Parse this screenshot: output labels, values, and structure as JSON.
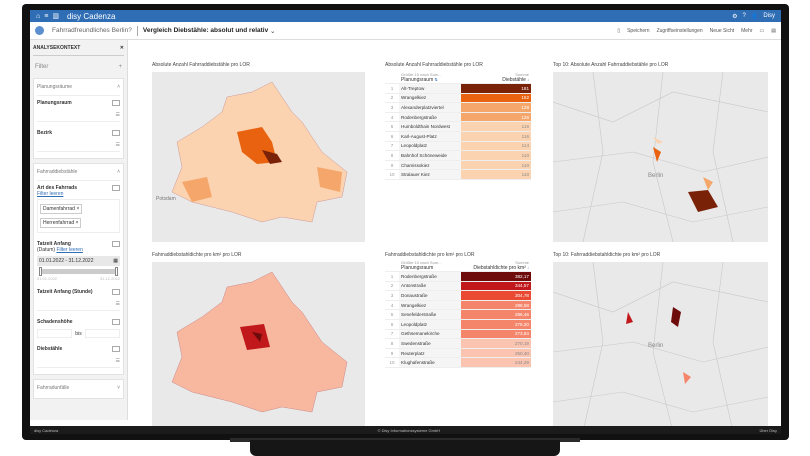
{
  "app": {
    "name": "disy Cadenza",
    "user": "Disy"
  },
  "toolbar": {
    "breadcrumb": "Fahrradfreundliches Berlin?",
    "title": "Vergleich Diebstähle: absolut und relativ",
    "save": "Speichern",
    "access": "Zugriffseinstellungen",
    "new_view": "Neue Sicht",
    "more": "Mehr"
  },
  "sidebar": {
    "header": "ANALYSEKONTEXT",
    "filter": "Filter",
    "group1": {
      "title": "Planungsräume",
      "f1": "Planungsraum",
      "f2": "Bezirk"
    },
    "group2": {
      "title": "Fahrraddiebstähle",
      "f1": "Art des Fahrrads",
      "clear": "Filter leeren",
      "chips": [
        "Damenfahrrad ×",
        "Herrenfahrrad ×"
      ],
      "f2a": "Tatzeit Anfang",
      "f2b": "(Datum)",
      "date": "01.01.2022 - 31.12.2022",
      "min": "01.01.2022",
      "max": "31.12.2022",
      "f3": "Tatzeit Anfang (Stunde)",
      "f4": "Schadenshöhe",
      "bis": "bis",
      "f5": "Diebstähle"
    },
    "group3": {
      "title": "Fahrradunfälle"
    }
  },
  "panels": {
    "map1_title": "Absolute Anzahl Fahrraddiebstähle pro LOR",
    "map2_title": "Fahrraddiebstahldichte pro km² pro LOR",
    "map3_title": "Top 10: Absolute Anzahl Fahrraddiebstähle pro LOR",
    "map4_title": "Top 10: Fahrraddiebstahldichte pro km² pro LOR",
    "map_labels": {
      "potsdam": "Potsdam",
      "berlin": "Berlin"
    },
    "table1": {
      "title": "Absolute Anzahl Fahrraddiebstähle pro LOR",
      "sub1": "Größte 10 nach Sum...",
      "col1": "Planungsraum",
      "sub2": "Summe",
      "col2": "Diebstähle",
      "rows": [
        [
          "1",
          "Alt-Treptow",
          "181",
          "#7a2208"
        ],
        [
          "2",
          "Wrangelkiez",
          "152",
          "#e8620f"
        ],
        [
          "3",
          "Alexanderplatzviertel",
          "129",
          "#f5a66a"
        ],
        [
          "4",
          "Rodenbergstraße",
          "126",
          "#f5a66a"
        ],
        [
          "5",
          "Humboldthain Nordwest",
          "116",
          "#fcd3b0"
        ],
        [
          "6",
          "Karl-August-Platz",
          "116",
          "#fcd3b0"
        ],
        [
          "7",
          "Leopoldplatz",
          "114",
          "#fcd3b0"
        ],
        [
          "8",
          "Bahnhof Schöneweide",
          "110",
          "#fcd3b0"
        ],
        [
          "9",
          "Chamissokiez",
          "110",
          "#fcd3b0"
        ],
        [
          "10",
          "Stralauer Kiez",
          "110",
          "#fcd3b0"
        ]
      ]
    },
    "table2": {
      "title": "Fahrraddiebstahldichte pro km² pro LOR",
      "sub1": "Größte 10 nach Sum...",
      "col1": "Planungsraum",
      "sub2": "Summe",
      "col2": "Diebstahldichte pro km²",
      "rows": [
        [
          "1",
          "Rodenbergstraße",
          "382,17",
          "#6e0b0b"
        ],
        [
          "2",
          "Antonstraße",
          "344,57",
          "#c0181b"
        ],
        [
          "3",
          "Donaustraße",
          "304,78",
          "#ea4a32"
        ],
        [
          "4",
          "Wrangelkiez",
          "288,58",
          "#f5856a"
        ],
        [
          "5",
          "Senefelderstraße",
          "286,46",
          "#f5856a"
        ],
        [
          "6",
          "Leopoldplatz",
          "279,20",
          "#f5856a"
        ],
        [
          "7",
          "Gethsemanekirche",
          "273,84",
          "#f5856a"
        ],
        [
          "8",
          "Swedenstraße",
          "270,19",
          "#fbc4b0"
        ],
        [
          "9",
          "Reuterplatz",
          "250,40",
          "#fbc4b0"
        ],
        [
          "10",
          "Klughafenstraße",
          "244,29",
          "#fbc4b0"
        ]
      ]
    }
  },
  "footer": {
    "left": "disy Cadenza",
    "center": "© Disy Informationssysteme GmbH",
    "right": "Über Disy"
  },
  "colors": {
    "header": "#2f6db5",
    "abs_scale": [
      "#fcd3b0",
      "#f5a66a",
      "#e8620f",
      "#7a2208"
    ],
    "dens_scale": [
      "#fbc4b0",
      "#f5856a",
      "#c0181b",
      "#6e0b0b"
    ]
  }
}
